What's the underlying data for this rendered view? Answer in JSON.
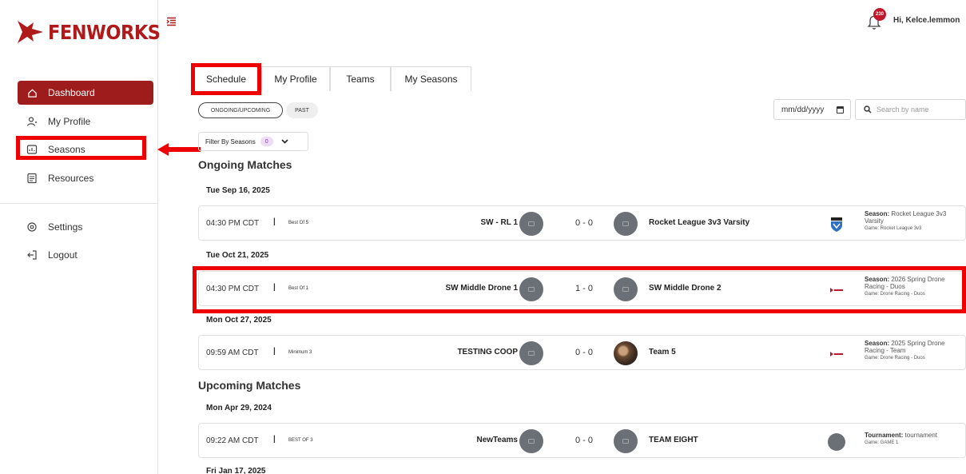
{
  "brand": {
    "name": "FENWORKS",
    "color": "#b01a1a"
  },
  "header": {
    "greeting": "Hi, Kelce.lemmon",
    "notification_count": "230"
  },
  "sidebar": {
    "items": [
      {
        "label": "Dashboard",
        "icon": "home-icon"
      },
      {
        "label": "My Profile",
        "icon": "user-icon"
      },
      {
        "label": "Seasons",
        "icon": "seasons-icon"
      },
      {
        "label": "Resources",
        "icon": "resources-icon"
      }
    ],
    "secondary": [
      {
        "label": "Settings",
        "icon": "gear-icon"
      },
      {
        "label": "Logout",
        "icon": "logout-icon"
      }
    ]
  },
  "tabs": [
    {
      "label": "Schedule"
    },
    {
      "label": "My Profile"
    },
    {
      "label": "Teams"
    },
    {
      "label": "My Seasons"
    }
  ],
  "filters": {
    "ongoing_label": "ONGOING/UPCOMING",
    "past_label": "PAST",
    "date_placeholder": "mm/dd/yyyy",
    "search_placeholder": "Search by name",
    "seasons_label": "Filter By Seasons",
    "seasons_count": "0"
  },
  "sections": {
    "ongoing": "Ongoing Matches",
    "upcoming": "Upcoming Matches"
  },
  "dates": [
    "Tue Sep 16, 2025",
    "Tue Oct 21, 2025",
    "Mon Oct 27, 2025",
    "Mon Apr 29, 2024",
    "Fri Jan 17, 2025"
  ],
  "matches": [
    {
      "time": "04:30 PM CDT",
      "format": "Best Of 5",
      "home": "SW - RL 1",
      "score": "0 - 0",
      "away": "Rocket League 3v3 Varsity",
      "season_key": "Season:",
      "season": "Rocket League 3v3 Varsity",
      "game": "Game: Rocket League 3v3"
    },
    {
      "time": "04:30 PM CDT",
      "format": "Best Of 1",
      "home": "SW Middle Drone 1",
      "score": "1 - 0",
      "away": "SW Middle Drone 2",
      "season_key": "Season:",
      "season": "2026 Spring Drone Racing - Duos",
      "game": "Game: Drone Racing - Duos"
    },
    {
      "time": "09:59 AM CDT",
      "format": "Minimum 3",
      "home": "TESTING COOP",
      "score": "0 - 0",
      "away": "Team 5",
      "season_key": "Season:",
      "season": "2025 Spring Drone Racing - Team",
      "game": "Game: Drone Racing - Duos"
    },
    {
      "time": "09:22 AM CDT",
      "format": "BEST OF 3",
      "home": "NewTeams",
      "score": "0 - 0",
      "away": "TEAM EIGHT",
      "season_key": "Tournament:",
      "season": "tournament",
      "game": "Game: GAME 1"
    }
  ],
  "separator": "|",
  "colors": {
    "accent": "#9e1c1c",
    "highlight": "#ee0000"
  }
}
